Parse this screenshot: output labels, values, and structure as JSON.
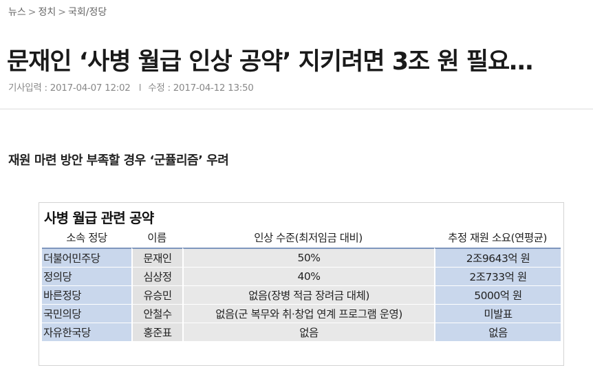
{
  "breadcrumb": {
    "items": [
      "뉴스",
      "정치",
      "국회/정당"
    ],
    "separator": ">"
  },
  "article": {
    "headline": "문재인 ‘사병 월급 인상 공약’ 지키려면 3조 원 필요…",
    "published_label": "기사입력 : 2017-04-07 12:02",
    "modified_label": "수정 : 2017-04-12 13:50",
    "meta_separator": "I",
    "subtitle": "재원 마련 방안 부족할 경우 ‘군퓰리즘’ 우려"
  },
  "table": {
    "title": "사병 월급 관련 공약",
    "headers": [
      "소속 정당",
      "이름",
      "인상 수준(최저임금 대비)",
      "추정 재원 소요(연평균)"
    ],
    "rows": [
      {
        "party": "더불어민주당",
        "name": "문재인",
        "level": "50%",
        "cost": "2조9643억 원"
      },
      {
        "party": "정의당",
        "name": "심상정",
        "level": "40%",
        "cost": "2조733억 원"
      },
      {
        "party": "바른정당",
        "name": "유승민",
        "level": "없음(장병 적금 장려금 대체)",
        "cost": "5000억 원"
      },
      {
        "party": "국민의당",
        "name": "안철수",
        "level": "없음(군 복무와 취·창업 연계 프로그램 운영)",
        "cost": "미발표"
      },
      {
        "party": "자유한국당",
        "name": "홍준표",
        "level": "없음",
        "cost": "없음"
      }
    ]
  },
  "colors": {
    "party_cell_bg": "#c9d7ec",
    "cost_cell_bg": "#c9d7ec",
    "name_cell_bg": "#e2e2e2",
    "level_cell_bg": "#e8e8e8",
    "header_rule": "#7e96bd"
  }
}
